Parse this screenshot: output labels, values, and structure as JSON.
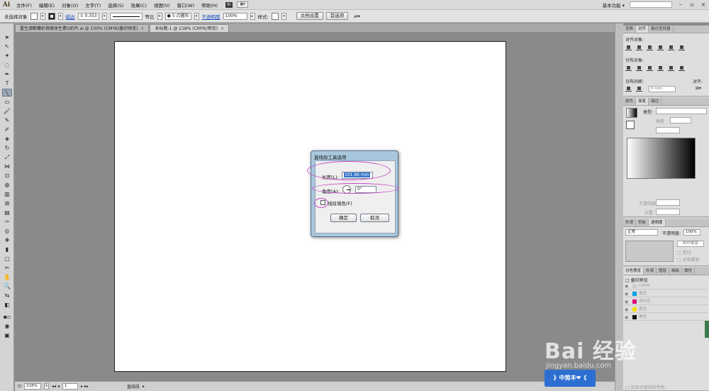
{
  "app": {
    "logo": "Ai"
  },
  "menu": {
    "items": [
      "文件(F)",
      "编辑(E)",
      "对象(O)",
      "文字(T)",
      "选择(S)",
      "效果(C)",
      "视图(V)",
      "窗口(W)",
      "帮助(H)"
    ],
    "bridge": "Br",
    "workspace": "基本功能 ▾"
  },
  "control": {
    "selection": "未选择对象",
    "stroke_label": "描边",
    "stroke_value": "0.353",
    "profile": "等比",
    "brush": "● 5 点圆形",
    "opacity_label": "不透明度",
    "opacity_value": "100%",
    "style_label": "样式:",
    "doc_settings": "文档设置",
    "preferences": "首选项"
  },
  "doc_tabs": [
    {
      "label": "重生源敷糠奶骨跟体生素D奶片.ai @ 100% (CMYK/叠印预览)",
      "close": "×"
    },
    {
      "label": "未标题-1 @ 218% (CMYK/预览)",
      "close": "×"
    }
  ],
  "dialog": {
    "title": "直线段工具选项",
    "length_label": "长度(L):",
    "length_value": "101.96 mm",
    "angle_label": "角度(A):",
    "angle_value": "0°",
    "fill_label": "线段填色(F)",
    "ok": "确定",
    "cancel": "取消"
  },
  "status": {
    "zoom": "218%",
    "page": "1",
    "tool": "直线段"
  },
  "panels": {
    "align": {
      "tabs": [
        "变换",
        "对齐",
        "路径查找器"
      ],
      "align_objects": "对齐对象:",
      "distribute_objects": "分布对象:",
      "distribute_spacing": "分布间距:",
      "spacing_value": "0 mm",
      "align_to": "对齐:"
    },
    "gradient": {
      "tabs": [
        "颜色",
        "渐变",
        "描边"
      ],
      "type_label": "类型:",
      "angle_label": "角度",
      "opacity_label": "不透明度",
      "position_label": "位置"
    },
    "transparency": {
      "tabs": [
        "外观",
        "色板",
        "透明度"
      ],
      "blend_mode": "正常",
      "opacity_label": "不透明度:",
      "opacity_value": "100%",
      "make_mask": "制作蒙版",
      "clip": "剪切",
      "invert_mask": "反相蒙版"
    },
    "separations": {
      "tabs": [
        "分色预览",
        "外观",
        "图层",
        "画板",
        "属性"
      ],
      "overprint": "叠印预览",
      "rows": [
        {
          "name": "CMYK",
          "color": "#cccccc"
        },
        {
          "name": "青色",
          "color": "#00a0e0"
        },
        {
          "name": "洋红色",
          "color": "#e0007a"
        },
        {
          "name": "黄色",
          "color": "#f4e000"
        },
        {
          "name": "黑色",
          "color": "#111111"
        }
      ],
      "footer": "仅显示使用的专色"
    }
  },
  "watermark": {
    "logo": "Bai 经验",
    "url": "jingyan.baidu.com",
    "badge": "》中简丰❤《"
  }
}
